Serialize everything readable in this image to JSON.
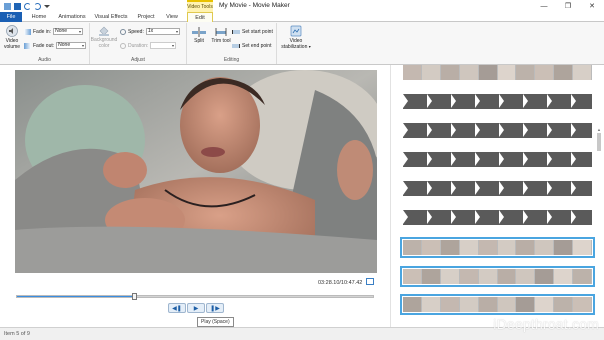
{
  "window": {
    "title": "My Movie - Movie Maker",
    "context_badge": "Video Tools",
    "controls": [
      "minimize-icon",
      "maximize-icon",
      "close-icon"
    ]
  },
  "tabs": [
    "File",
    "Home",
    "Animations",
    "Visual Effects",
    "Project",
    "View",
    "Edit"
  ],
  "active_tab": "Edit",
  "ribbon": {
    "audio": {
      "label": "Audio",
      "video_volume": "Video volume",
      "fade_in_label": "Fade in:",
      "fade_in_value": "None",
      "fade_out_label": "Fade out:",
      "fade_out_value": "None"
    },
    "adjust": {
      "label": "Adjust",
      "background_color": "Background color",
      "speed_label": "Speed:",
      "speed_value": "1x",
      "duration_label": "Duration:",
      "duration_value": ""
    },
    "editing": {
      "label": "Editing",
      "split": "Split",
      "trim_tool": "Trim tool",
      "set_start": "Set start point",
      "set_end": "Set end point"
    },
    "stabilization": {
      "label": "Video stabilization"
    }
  },
  "preview": {
    "timecode": "03:28.10/10:47.42",
    "seek_progress": 0.33,
    "tooltip": "Play (Space)"
  },
  "storyboard": {
    "strips": [
      {
        "kind": "video",
        "selected": false
      },
      {
        "kind": "title",
        "selected": false
      },
      {
        "kind": "title",
        "selected": false
      },
      {
        "kind": "title",
        "selected": false
      },
      {
        "kind": "title",
        "selected": false
      },
      {
        "kind": "title",
        "selected": false
      },
      {
        "kind": "video",
        "selected": true
      },
      {
        "kind": "video",
        "selected": true
      },
      {
        "kind": "video",
        "selected": true
      }
    ]
  },
  "status": {
    "item": "Item 5 of 9"
  },
  "watermark": "iDeepthroat.com",
  "colors": {
    "file_tab": "#1a5fb4",
    "selection": "#4aa5e0",
    "title_clip": "#5a5a5a"
  }
}
